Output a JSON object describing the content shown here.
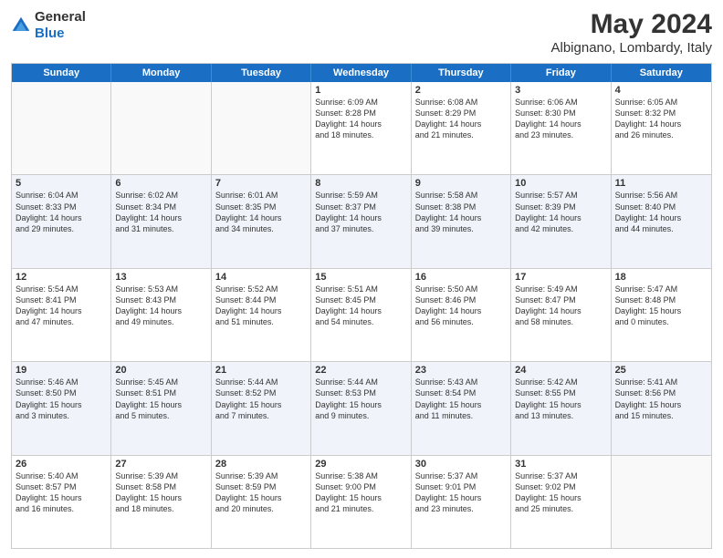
{
  "header": {
    "logo_general": "General",
    "logo_blue": "Blue",
    "main_title": "May 2024",
    "subtitle": "Albignano, Lombardy, Italy"
  },
  "days_of_week": [
    "Sunday",
    "Monday",
    "Tuesday",
    "Wednesday",
    "Thursday",
    "Friday",
    "Saturday"
  ],
  "rows": [
    {
      "alt": false,
      "cells": [
        {
          "day": "",
          "info": ""
        },
        {
          "day": "",
          "info": ""
        },
        {
          "day": "",
          "info": ""
        },
        {
          "day": "1",
          "info": "Sunrise: 6:09 AM\nSunset: 8:28 PM\nDaylight: 14 hours\nand 18 minutes."
        },
        {
          "day": "2",
          "info": "Sunrise: 6:08 AM\nSunset: 8:29 PM\nDaylight: 14 hours\nand 21 minutes."
        },
        {
          "day": "3",
          "info": "Sunrise: 6:06 AM\nSunset: 8:30 PM\nDaylight: 14 hours\nand 23 minutes."
        },
        {
          "day": "4",
          "info": "Sunrise: 6:05 AM\nSunset: 8:32 PM\nDaylight: 14 hours\nand 26 minutes."
        }
      ]
    },
    {
      "alt": true,
      "cells": [
        {
          "day": "5",
          "info": "Sunrise: 6:04 AM\nSunset: 8:33 PM\nDaylight: 14 hours\nand 29 minutes."
        },
        {
          "day": "6",
          "info": "Sunrise: 6:02 AM\nSunset: 8:34 PM\nDaylight: 14 hours\nand 31 minutes."
        },
        {
          "day": "7",
          "info": "Sunrise: 6:01 AM\nSunset: 8:35 PM\nDaylight: 14 hours\nand 34 minutes."
        },
        {
          "day": "8",
          "info": "Sunrise: 5:59 AM\nSunset: 8:37 PM\nDaylight: 14 hours\nand 37 minutes."
        },
        {
          "day": "9",
          "info": "Sunrise: 5:58 AM\nSunset: 8:38 PM\nDaylight: 14 hours\nand 39 minutes."
        },
        {
          "day": "10",
          "info": "Sunrise: 5:57 AM\nSunset: 8:39 PM\nDaylight: 14 hours\nand 42 minutes."
        },
        {
          "day": "11",
          "info": "Sunrise: 5:56 AM\nSunset: 8:40 PM\nDaylight: 14 hours\nand 44 minutes."
        }
      ]
    },
    {
      "alt": false,
      "cells": [
        {
          "day": "12",
          "info": "Sunrise: 5:54 AM\nSunset: 8:41 PM\nDaylight: 14 hours\nand 47 minutes."
        },
        {
          "day": "13",
          "info": "Sunrise: 5:53 AM\nSunset: 8:43 PM\nDaylight: 14 hours\nand 49 minutes."
        },
        {
          "day": "14",
          "info": "Sunrise: 5:52 AM\nSunset: 8:44 PM\nDaylight: 14 hours\nand 51 minutes."
        },
        {
          "day": "15",
          "info": "Sunrise: 5:51 AM\nSunset: 8:45 PM\nDaylight: 14 hours\nand 54 minutes."
        },
        {
          "day": "16",
          "info": "Sunrise: 5:50 AM\nSunset: 8:46 PM\nDaylight: 14 hours\nand 56 minutes."
        },
        {
          "day": "17",
          "info": "Sunrise: 5:49 AM\nSunset: 8:47 PM\nDaylight: 14 hours\nand 58 minutes."
        },
        {
          "day": "18",
          "info": "Sunrise: 5:47 AM\nSunset: 8:48 PM\nDaylight: 15 hours\nand 0 minutes."
        }
      ]
    },
    {
      "alt": true,
      "cells": [
        {
          "day": "19",
          "info": "Sunrise: 5:46 AM\nSunset: 8:50 PM\nDaylight: 15 hours\nand 3 minutes."
        },
        {
          "day": "20",
          "info": "Sunrise: 5:45 AM\nSunset: 8:51 PM\nDaylight: 15 hours\nand 5 minutes."
        },
        {
          "day": "21",
          "info": "Sunrise: 5:44 AM\nSunset: 8:52 PM\nDaylight: 15 hours\nand 7 minutes."
        },
        {
          "day": "22",
          "info": "Sunrise: 5:44 AM\nSunset: 8:53 PM\nDaylight: 15 hours\nand 9 minutes."
        },
        {
          "day": "23",
          "info": "Sunrise: 5:43 AM\nSunset: 8:54 PM\nDaylight: 15 hours\nand 11 minutes."
        },
        {
          "day": "24",
          "info": "Sunrise: 5:42 AM\nSunset: 8:55 PM\nDaylight: 15 hours\nand 13 minutes."
        },
        {
          "day": "25",
          "info": "Sunrise: 5:41 AM\nSunset: 8:56 PM\nDaylight: 15 hours\nand 15 minutes."
        }
      ]
    },
    {
      "alt": false,
      "cells": [
        {
          "day": "26",
          "info": "Sunrise: 5:40 AM\nSunset: 8:57 PM\nDaylight: 15 hours\nand 16 minutes."
        },
        {
          "day": "27",
          "info": "Sunrise: 5:39 AM\nSunset: 8:58 PM\nDaylight: 15 hours\nand 18 minutes."
        },
        {
          "day": "28",
          "info": "Sunrise: 5:39 AM\nSunset: 8:59 PM\nDaylight: 15 hours\nand 20 minutes."
        },
        {
          "day": "29",
          "info": "Sunrise: 5:38 AM\nSunset: 9:00 PM\nDaylight: 15 hours\nand 21 minutes."
        },
        {
          "day": "30",
          "info": "Sunrise: 5:37 AM\nSunset: 9:01 PM\nDaylight: 15 hours\nand 23 minutes."
        },
        {
          "day": "31",
          "info": "Sunrise: 5:37 AM\nSunset: 9:02 PM\nDaylight: 15 hours\nand 25 minutes."
        },
        {
          "day": "",
          "info": ""
        }
      ]
    }
  ]
}
